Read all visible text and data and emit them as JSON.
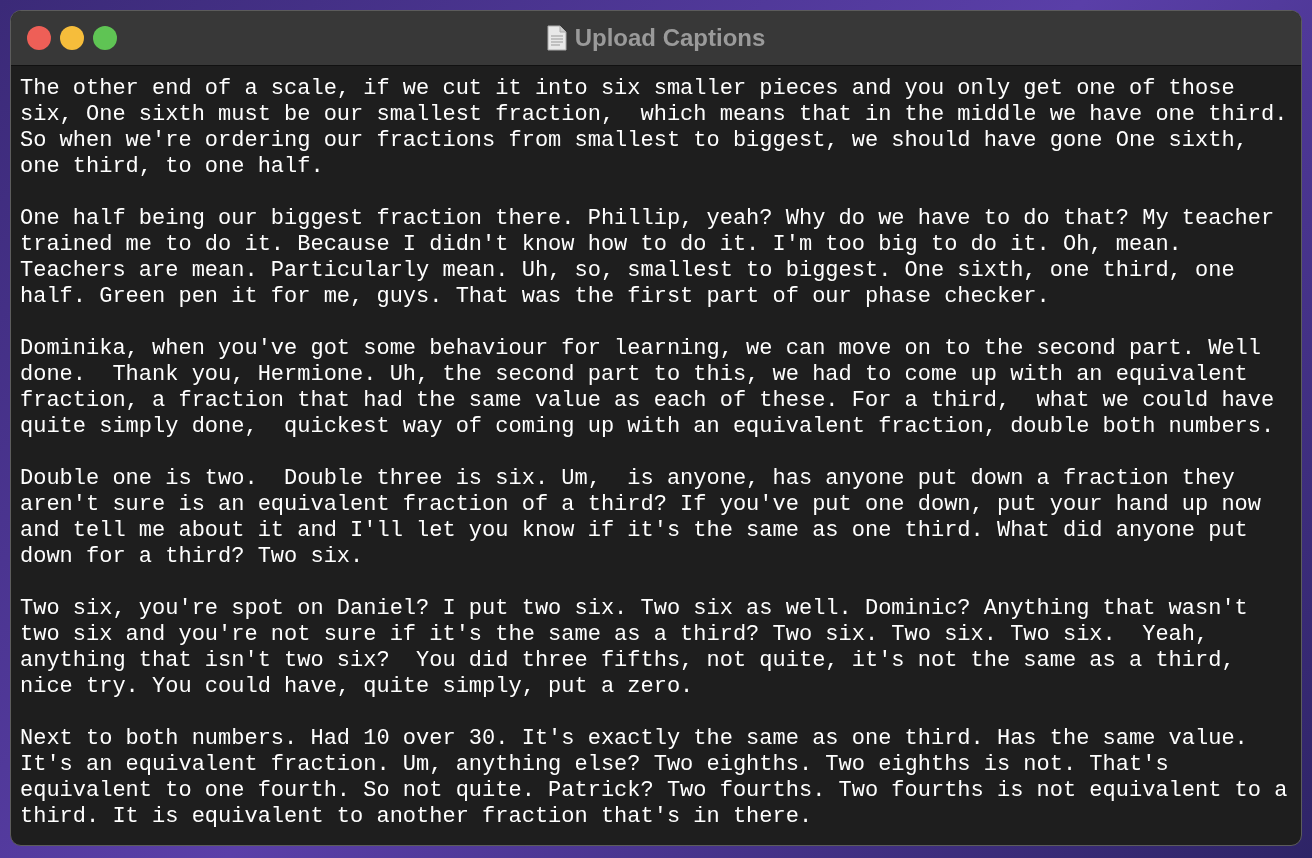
{
  "window": {
    "title": "Upload Captions"
  },
  "paragraphs": [
    "The other end of a scale, if we cut it into six smaller pieces and you only get one of those six, One sixth must be our smallest fraction,  which means that in the middle we have one third. So when we're ordering our fractions from smallest to biggest, we should have gone One sixth, one third, to one half.",
    "One half being our biggest fraction there. Phillip, yeah? Why do we have to do that? My teacher trained me to do it. Because I didn't know how to do it. I'm too big to do it. Oh, mean. Teachers are mean. Particularly mean. Uh, so, smallest to biggest. One sixth, one third, one half. Green pen it for me, guys. That was the first part of our phase checker.",
    "Dominika, when you've got some behaviour for learning, we can move on to the second part. Well done.  Thank you, Hermione. Uh, the second part to this, we had to come up with an equivalent fraction, a fraction that had the same value as each of these. For a third,  what we could have quite simply done,  quickest way of coming up with an equivalent fraction, double both numbers.",
    "Double one is two.  Double three is six. Um,  is anyone, has anyone put down a fraction they aren't sure is an equivalent fraction of a third? If you've put one down, put your hand up now and tell me about it and I'll let you know if it's the same as one third. What did anyone put down for a third? Two six.",
    "Two six, you're spot on Daniel? I put two six. Two six as well. Dominic? Anything that wasn't two six and you're not sure if it's the same as a third? Two six. Two six. Two six.  Yeah, anything that isn't two six?  You did three fifths, not quite, it's not the same as a third, nice try. You could have, quite simply, put a zero.",
    "Next to both numbers. Had 10 over 30. It's exactly the same as one third. Has the same value. It's an equivalent fraction. Um, anything else? Two eighths. Two eighths is not. That's equivalent to one fourth. So not quite. Patrick? Two fourths. Two fourths is not equivalent to a third. It is equivalent to another fraction that's in there."
  ]
}
